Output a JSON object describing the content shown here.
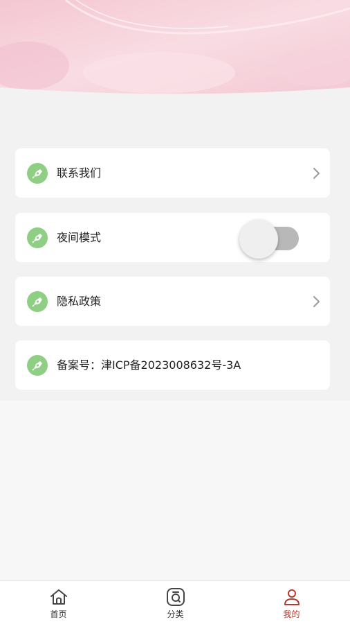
{
  "menu": {
    "contact": {
      "label": "联系我们",
      "icon": "pen-nib-icon"
    },
    "night_mode": {
      "label": "夜间模式",
      "icon": "pen-nib-icon",
      "enabled": false
    },
    "privacy": {
      "label": "隐私政策",
      "icon": "pen-nib-icon"
    },
    "icp": {
      "label": "备案号：津ICP备2023008632号-3A",
      "icon": "pen-nib-icon"
    }
  },
  "tabbar": {
    "items": [
      {
        "label": "首页",
        "icon": "home-icon",
        "active": false
      },
      {
        "label": "分类",
        "icon": "category-search-icon",
        "active": false
      },
      {
        "label": "我的",
        "icon": "user-profile-icon",
        "active": true
      }
    ]
  },
  "colors": {
    "icon_green": "#8fcf83",
    "active_tab": "#b03a2e",
    "header_pink": "#f7d3dc"
  }
}
